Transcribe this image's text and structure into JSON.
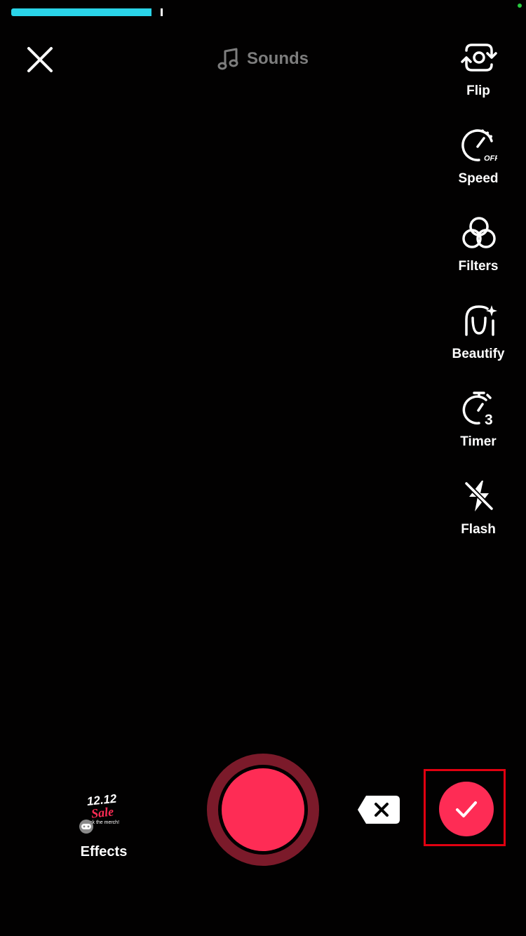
{
  "header": {
    "sounds_label": "Sounds",
    "recording_progress_fraction": 0.3
  },
  "side_tools": [
    {
      "label": "Flip",
      "icon": "flip-camera-icon"
    },
    {
      "label": "Speed",
      "icon": "speed-icon",
      "badge": "OFF"
    },
    {
      "label": "Filters",
      "icon": "filters-icon"
    },
    {
      "label": "Beautify",
      "icon": "beautify-icon"
    },
    {
      "label": "Timer",
      "icon": "timer-icon",
      "badge": "3"
    },
    {
      "label": "Flash",
      "icon": "flash-off-icon"
    }
  ],
  "bottom": {
    "effects_label": "Effects",
    "effects_thumb_line1": "12.12",
    "effects_thumb_line2": "Sale",
    "effects_thumb_line3": "ck the merch!"
  },
  "colors": {
    "accent": "#fe2c55",
    "record_ring": "#7b1a2a",
    "progress": "#2ad4e8",
    "highlight": "#e10010"
  }
}
